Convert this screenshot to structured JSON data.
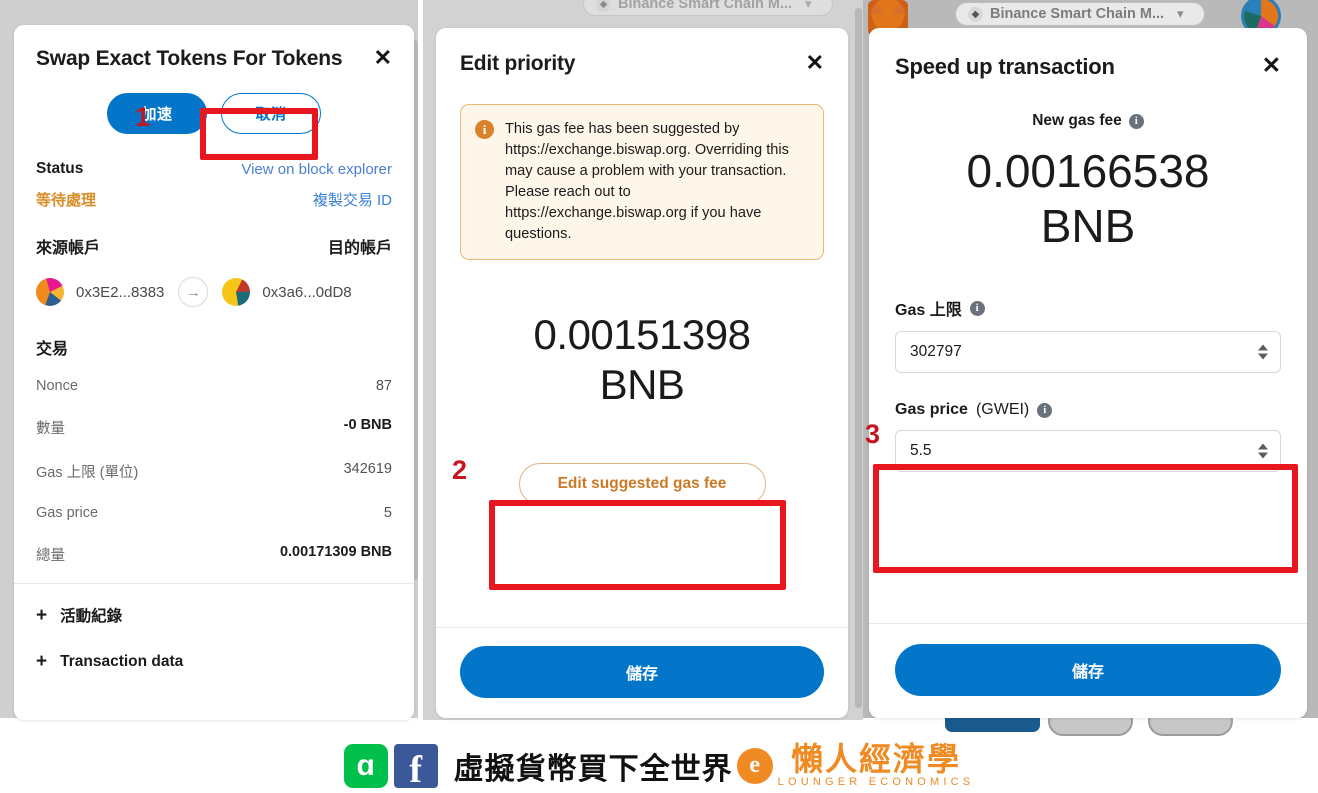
{
  "browser": {
    "network_pill_label": "Binance Smart Chain M...",
    "network_pill_icon": "bnb-icon",
    "chevron": "⌄"
  },
  "panel1": {
    "title": "Swap Exact Tokens For Tokens",
    "close": "✕",
    "speedup_label": "加速",
    "cancel_label": "取消",
    "status_label": "Status",
    "explorer_link": "View on block explorer",
    "status_value": "等待處理",
    "copy_txid_link": "複製交易 ID",
    "from_label": "來源帳戶",
    "to_label": "目的帳戶",
    "from_address": "0x3E2...8383",
    "to_address": "0x3a6...0dD8",
    "arrow": "→",
    "section_tx": "交易",
    "rows": [
      {
        "key": "Nonce",
        "value": "87",
        "bold": false
      },
      {
        "key": "數量",
        "value": "-0 BNB",
        "bold": true
      },
      {
        "key": "Gas 上限 (單位)",
        "value": "342619",
        "bold": false
      },
      {
        "key": "Gas price",
        "value": "5",
        "bold": false
      },
      {
        "key": "總量",
        "value": "0.00171309 BNB",
        "bold": true
      }
    ],
    "expand_activity": "活動紀錄",
    "expand_txdata": "Transaction data",
    "plus": "+"
  },
  "panel2": {
    "title": "Edit priority",
    "close": "✕",
    "alert_icon": "info-icon",
    "alert_text": "This gas fee has been suggested by https://exchange.biswap.org. Overriding this may cause a problem with your transaction. Please reach out to https://exchange.biswap.org if you have questions.",
    "amount": "0.00151398",
    "currency": "BNB",
    "edit_gas_label": "Edit suggested gas fee",
    "save_label": "儲存"
  },
  "panel3": {
    "title": "Speed up transaction",
    "close": "✕",
    "new_gas_fee_label": "New gas fee",
    "info_icon": "info-icon",
    "amount": "0.00166538",
    "currency": "BNB",
    "gas_limit_label": "Gas 上限",
    "gas_limit_value": "302797",
    "gas_price_label_bold": "Gas price",
    "gas_price_label_norm": "(GWEI)",
    "gas_price_value": "5.5",
    "save_label": "儲存"
  },
  "annotations": {
    "step1": "1",
    "step2": "2",
    "step3": "3",
    "box_color": "#e8171f"
  },
  "branding": {
    "line_icon": "line-icon",
    "line_glyph": "ɑ",
    "facebook_icon": "facebook-icon",
    "facebook_glyph": "f",
    "tagline": "虛擬貨幣買下全世界",
    "logo_glyph": "e",
    "name_cn": "懶人經濟學",
    "name_en": "LOUNGER ECONOMICS"
  },
  "colors": {
    "primary_blue": "#0376c9",
    "accent_orange": "#d9822b",
    "annotation_red": "#e8171f",
    "brand_orange": "#f08a22",
    "brand_green": "#00c04b",
    "brand_blue": "#3b5998"
  }
}
